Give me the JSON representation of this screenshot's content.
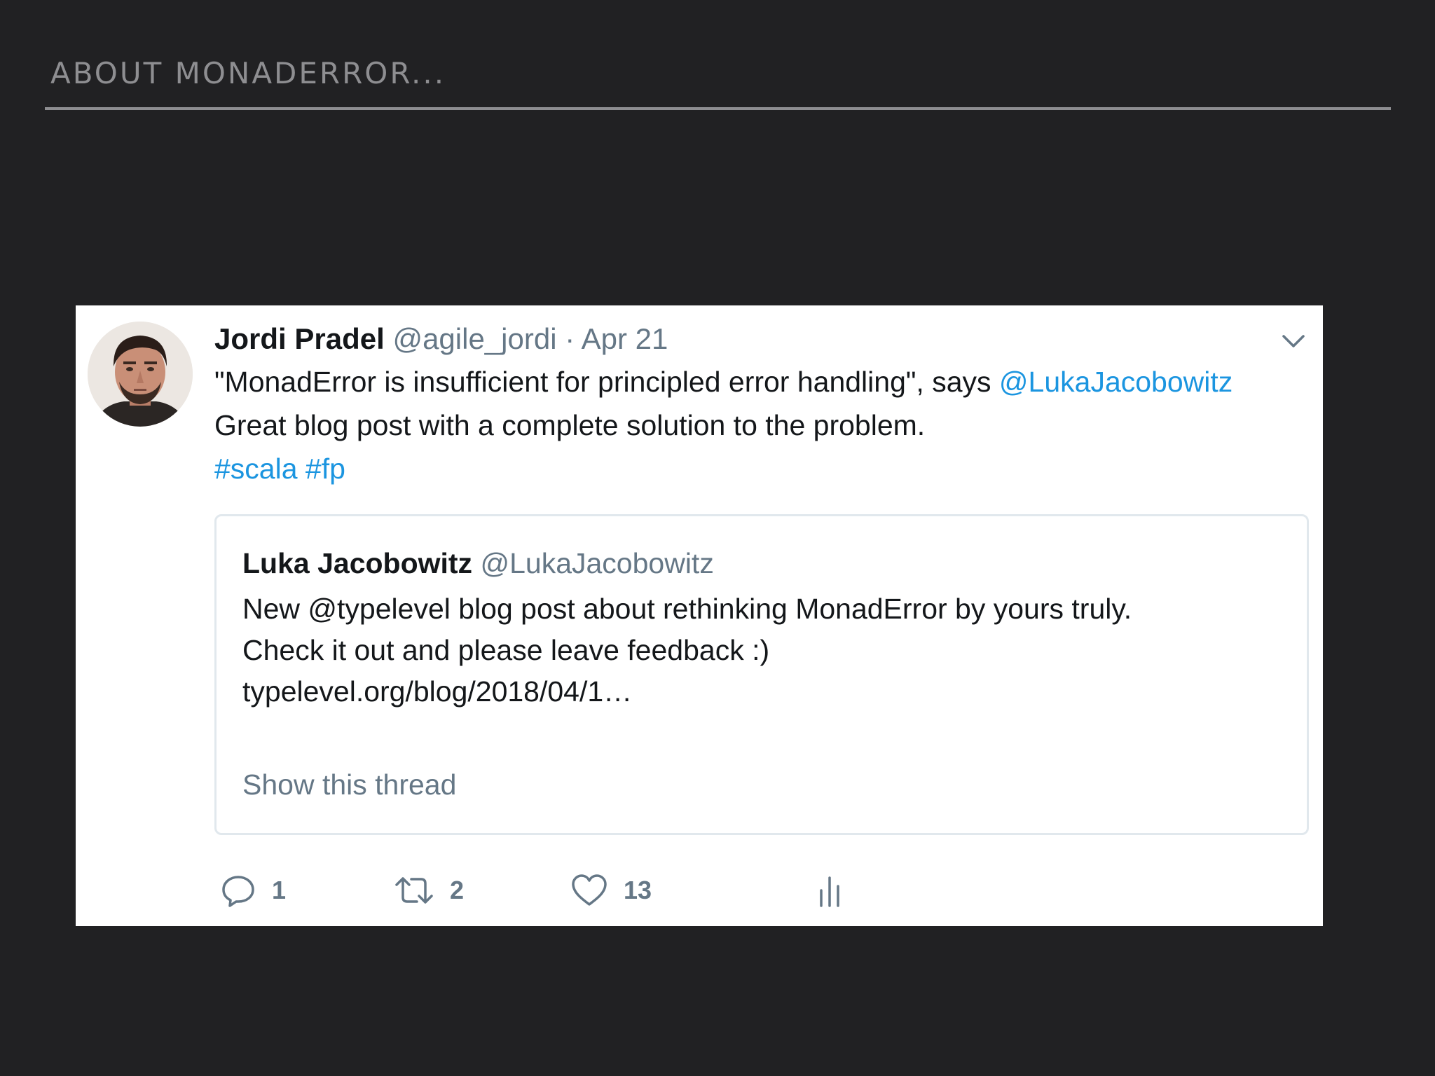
{
  "slide": {
    "title": "ABOUT MONADERROR..."
  },
  "tweet": {
    "author_name": "Jordi Pradel",
    "author_handle": "@agile_jordi",
    "separator": "·",
    "date": "Apr 21",
    "text_line1_start": "\"MonadError is insufficient for principled error handling\", says ",
    "mention": "@LukaJacobowitz",
    "text_line2": "Great blog post with a complete solution to the problem.",
    "hashtags": [
      "#scala",
      "#fp"
    ],
    "quoted": {
      "author_name": "Luka Jacobowitz",
      "author_handle": "@LukaJacobowitz",
      "lines": [
        "New @typelevel blog post about rethinking MonadError by yours truly.",
        "Check it out and please leave feedback :)",
        "typelevel.org/blog/2018/04/1…"
      ],
      "show_thread": "Show this thread"
    },
    "actions": {
      "replies": "1",
      "retweets": "2",
      "likes": "13"
    }
  },
  "icons": {
    "menu": "chevron-down-icon",
    "reply": "reply-icon",
    "retweet": "retweet-icon",
    "like": "heart-icon",
    "analytics": "analytics-icon"
  },
  "colors": {
    "background": "#212123",
    "title": "#8e8e91",
    "link": "#1b95e0",
    "muted": "#657786",
    "text": "#14171a"
  }
}
